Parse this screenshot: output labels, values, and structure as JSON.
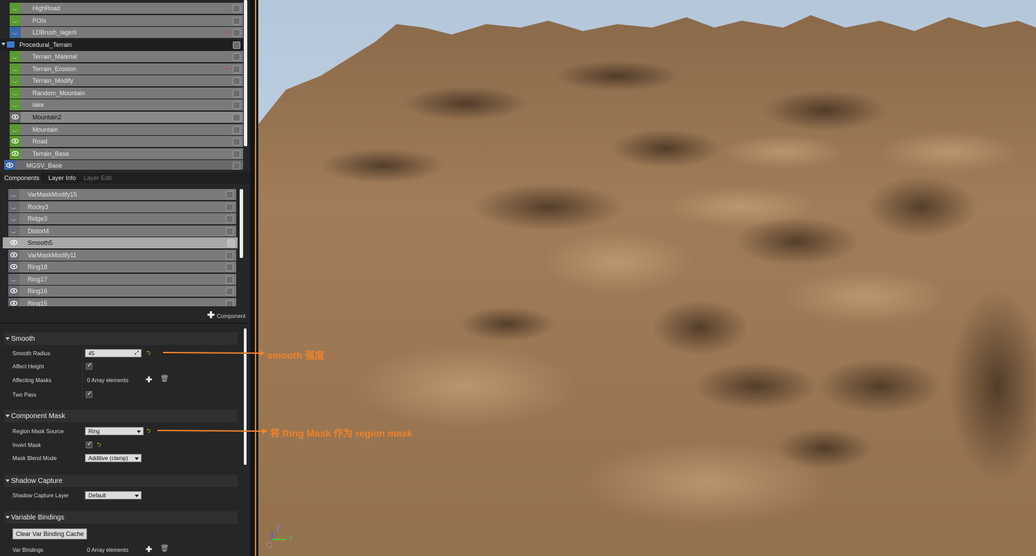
{
  "layers": [
    {
      "label": "HighRoad",
      "icon": "layer-icon",
      "color": "#5a9a30",
      "visible": false,
      "dot": false
    },
    {
      "label": "POIs",
      "icon": "layer-icon",
      "color": "#5a9a30",
      "visible": false,
      "dot": false
    },
    {
      "label": "LDBrush_lagerli",
      "icon": "layer-icon",
      "color": "#3a68a8",
      "visible": false,
      "dot": true
    },
    {
      "label": "Procedural_Terrain",
      "icon": "folder-icon",
      "color": "#3a7ad0",
      "visible": false,
      "dot": false,
      "folder": true
    },
    {
      "label": "Terrain_Material",
      "icon": "layer-icon",
      "color": "#5a9a30",
      "visible": false,
      "dot": false
    },
    {
      "label": "Terrain_Erosion",
      "icon": "layer-icon",
      "color": "#5a9a30",
      "visible": false,
      "dot": true
    },
    {
      "label": "Terrain_Modify",
      "icon": "layer-icon",
      "color": "#5a9a30",
      "visible": false,
      "dot": false
    },
    {
      "label": "Random_Mountain",
      "icon": "layer-icon",
      "color": "#5a9a30",
      "visible": false,
      "dot": false
    },
    {
      "label": "lake",
      "icon": "layer-icon",
      "color": "#5a9a30",
      "visible": false,
      "dot": false
    },
    {
      "label": "Mountain2",
      "icon": "eye-icon",
      "color": "#6a6a6a",
      "visible": true,
      "dot": false,
      "selected": true
    },
    {
      "label": "Mountain",
      "icon": "layer-icon",
      "color": "#5a9a30",
      "visible": false,
      "dot": false
    },
    {
      "label": "Road",
      "icon": "eye-icon",
      "color": "#5a9a30",
      "visible": true,
      "dot": false
    },
    {
      "label": "Terrain_Base",
      "icon": "eye-icon",
      "color": "#5a9a30",
      "visible": true,
      "dot": false
    },
    {
      "label": "MGSV_Base",
      "icon": "eye-icon",
      "color": "#3a68a8",
      "visible": true,
      "dot": false,
      "top": true
    }
  ],
  "tabs": {
    "components": "Components",
    "layer_info": "Layer Info",
    "layer_edit": "Layer Edit"
  },
  "components": [
    {
      "label": "VarMaskModify15",
      "visible": false
    },
    {
      "label": "Rocky3",
      "visible": false
    },
    {
      "label": "Ridge3",
      "visible": false
    },
    {
      "label": "Distort4",
      "visible": false
    },
    {
      "label": "Smooth5",
      "visible": true,
      "selected": true
    },
    {
      "label": "VarMaskModify11",
      "visible": true
    },
    {
      "label": "Ring18",
      "visible": true
    },
    {
      "label": "Ring17",
      "visible": false
    },
    {
      "label": "Ring16",
      "visible": true
    },
    {
      "label": "Ring15",
      "visible": true
    }
  ],
  "add_component": "Component",
  "smooth": {
    "title": "Smooth",
    "radius_label": "Smooth Radius",
    "radius_value": "45",
    "affect_height_label": "Affect Height",
    "affecting_masks_label": "Affecting Masks",
    "affecting_masks_value": "0 Array elements",
    "two_pass_label": "Two Pass"
  },
  "mask": {
    "title": "Component Mask",
    "region_source_label": "Region Mask Source",
    "region_source_value": "Ring",
    "invert_label": "Invert Mask",
    "blend_label": "Mask Blend Mode",
    "blend_value": "Additive (clamp)"
  },
  "shadow": {
    "title": "Shadow Capture",
    "layer_label": "Shadow Capture Layer",
    "layer_value": "Default"
  },
  "bindings": {
    "title": "Variable Bindings",
    "clear_button": "Clear Var Binding Cache",
    "var_label": "Var Bindings",
    "var_value": "0 Array elements"
  },
  "annotations": {
    "smooth": "smooth 强度",
    "ring": "将 Ring Mask 作为 region mask"
  },
  "gizmo": {
    "z": "Z",
    "y": "Y"
  },
  "colors": {
    "accent": "#f0822a",
    "terrain": "#9a7552",
    "sky": "#c8d6e4"
  }
}
